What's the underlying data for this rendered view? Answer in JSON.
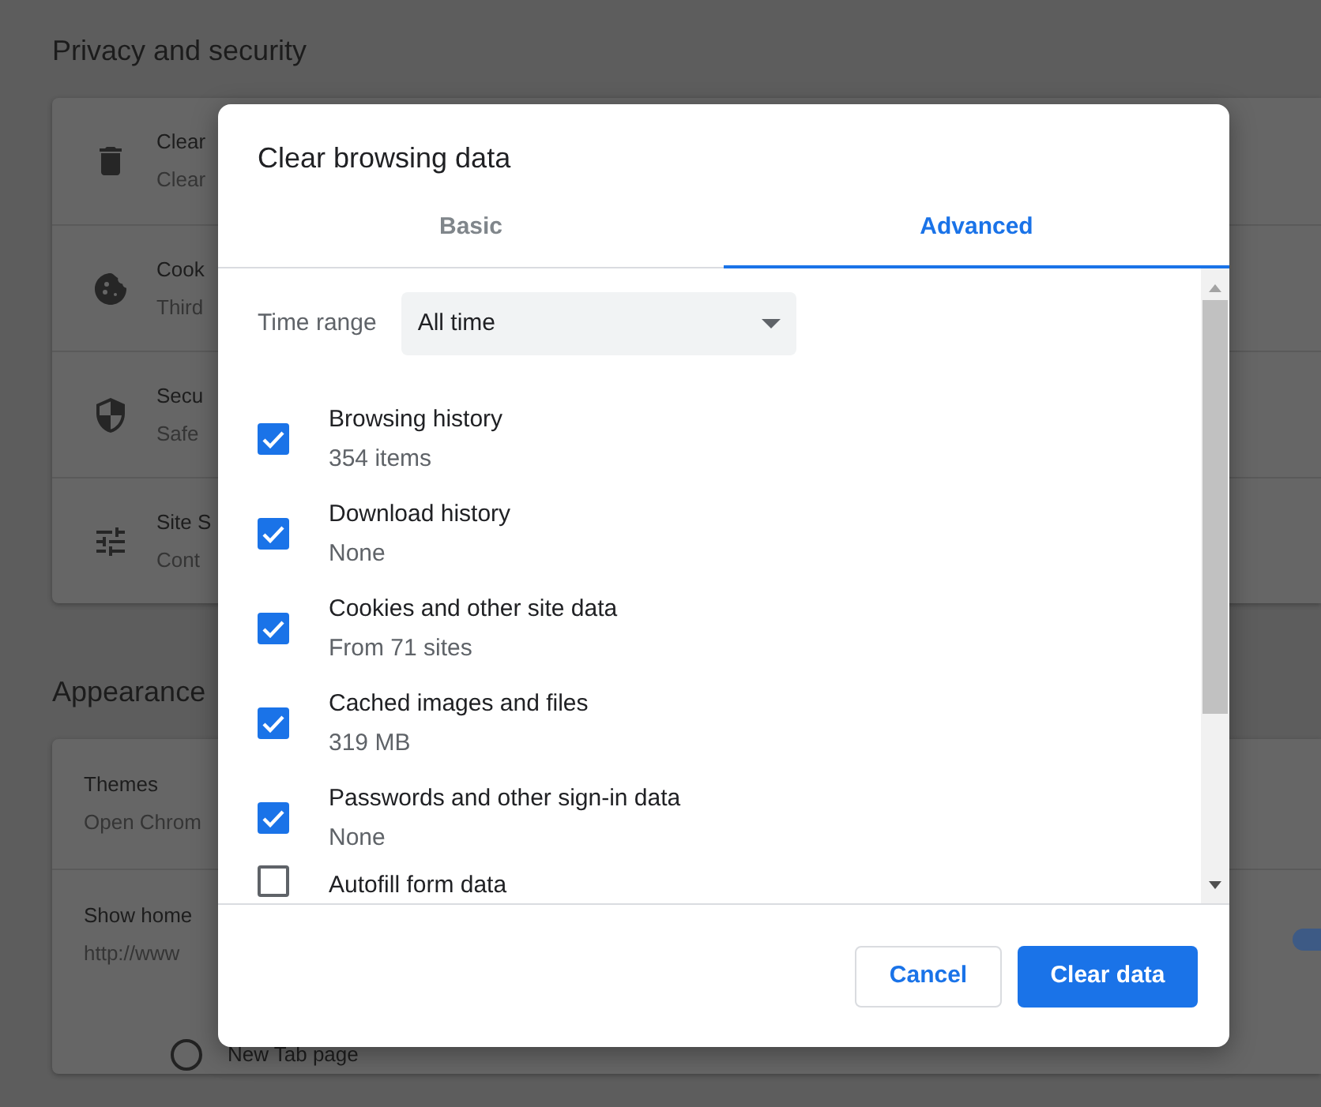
{
  "settings": {
    "sections": [
      {
        "heading": "Privacy and security",
        "rows": [
          {
            "title": "Clear",
            "subtitle": "Clear"
          },
          {
            "title": "Cook",
            "subtitle": "Third"
          },
          {
            "title": "Secu",
            "subtitle": "Safe"
          },
          {
            "title": "Site S",
            "subtitle": "Cont"
          }
        ]
      },
      {
        "heading": "Appearance",
        "rows": [
          {
            "title": "Themes",
            "subtitle": "Open Chrom"
          },
          {
            "title": "Show home",
            "subtitle": "http://www",
            "toggle": {
              "on": true
            },
            "options": [
              {
                "label": "New Tab page",
                "selected": false
              }
            ]
          }
        ]
      }
    ]
  },
  "dialog": {
    "title": "Clear browsing data",
    "tabs": [
      {
        "label": "Basic",
        "selected": false
      },
      {
        "label": "Advanced",
        "selected": true
      }
    ],
    "time_range": {
      "label": "Time range",
      "value": "All time"
    },
    "items": [
      {
        "title": "Browsing history",
        "detail": "354 items",
        "checked": true
      },
      {
        "title": "Download history",
        "detail": "None",
        "checked": true
      },
      {
        "title": "Cookies and other site data",
        "detail": "From 71 sites",
        "checked": true
      },
      {
        "title": "Cached images and files",
        "detail": "319 MB",
        "checked": true
      },
      {
        "title": "Passwords and other sign-in data",
        "detail": "None",
        "checked": true
      },
      {
        "title": "Autofill form data",
        "checked": false
      }
    ],
    "buttons": [
      {
        "label": "Cancel",
        "kind": "secondary"
      },
      {
        "label": "Clear data",
        "kind": "primary"
      }
    ]
  }
}
